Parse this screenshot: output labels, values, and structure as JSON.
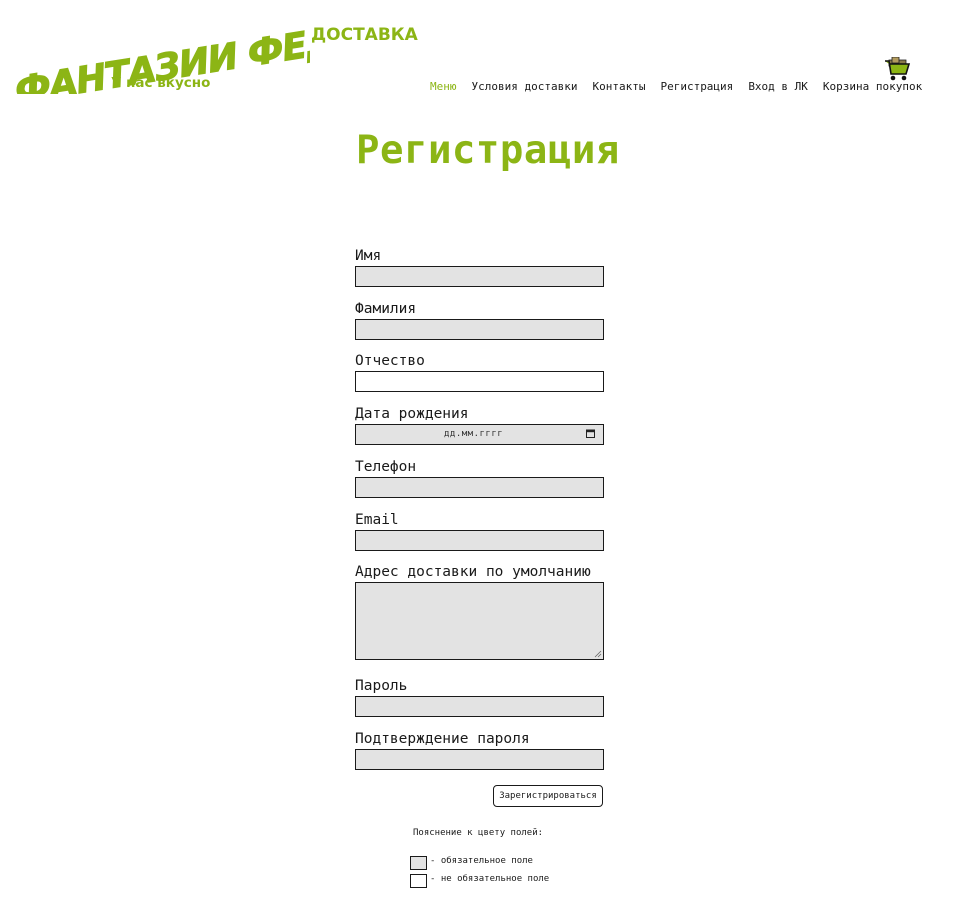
{
  "brand": {
    "logo_text": "ФАНТАЗИИ ФЕДОРА",
    "slogan": "У нас вкусно",
    "subtitle": "ДОСТАВКА"
  },
  "nav": {
    "items": [
      "Меню",
      "Условия доставки",
      "Контакты",
      "Регистрация",
      "Вход в ЛК",
      "Корзина покупок"
    ],
    "active_index": 0
  },
  "page": {
    "title": "Регистрация"
  },
  "form": {
    "fields": [
      {
        "label": "Имя",
        "value": "",
        "required": true
      },
      {
        "label": "Фамилия",
        "value": "",
        "required": true
      },
      {
        "label": "Отчество",
        "value": "",
        "required": false
      },
      {
        "label": "Дата рождения",
        "placeholder": "дд.мм.гггг",
        "required": true
      },
      {
        "label": "Телефон",
        "value": "",
        "required": true
      },
      {
        "label": "Email",
        "value": "",
        "required": true
      },
      {
        "label": "Адрес доставки по умолчанию",
        "value": "",
        "required": true
      },
      {
        "label": "Пароль",
        "value": "",
        "required": true
      },
      {
        "label": "Подтверждение пароля",
        "value": "",
        "required": true
      }
    ],
    "submit_label": "Зарегистрироваться"
  },
  "legend": {
    "title": "Пояснение к цвету полей:",
    "required_text": "- обязательное поле",
    "optional_text": "- не обязательное поле"
  },
  "colors": {
    "accent": "#8cb515",
    "required_field_bg": "#e3e3e3",
    "optional_field_bg": "#ffffff"
  },
  "icons": [
    "shopping-cart-icon",
    "calendar-icon",
    "resize-grip-icon"
  ]
}
